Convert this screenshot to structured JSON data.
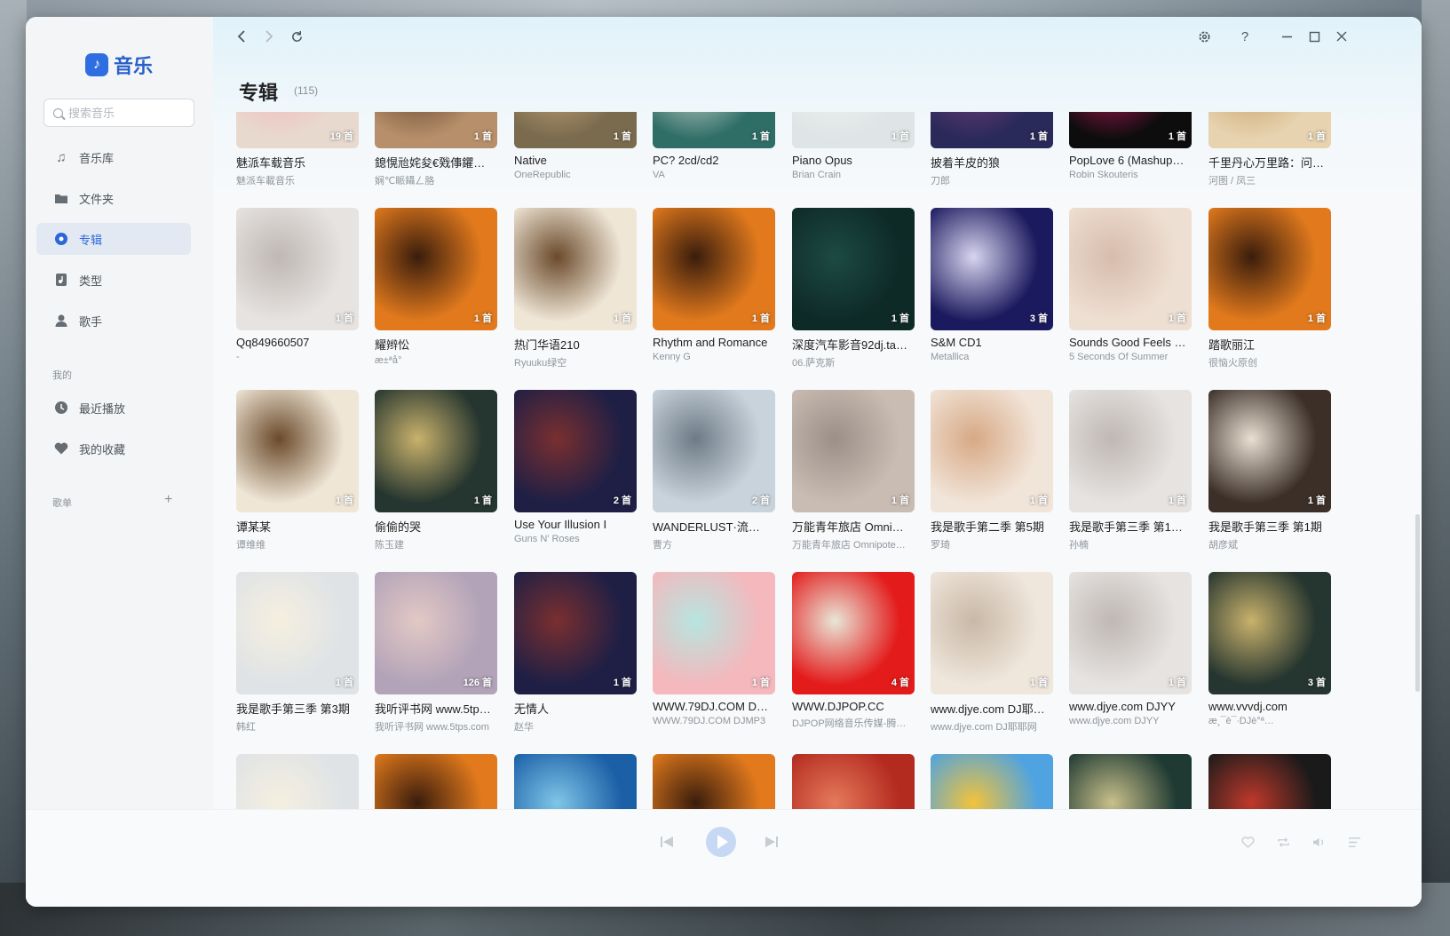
{
  "app": {
    "name": "音乐"
  },
  "search": {
    "placeholder": "搜索音乐"
  },
  "sidebar": {
    "items": [
      {
        "label": "音乐库",
        "icon": "music-note-icon"
      },
      {
        "label": "文件夹",
        "icon": "folder-icon"
      },
      {
        "label": "专辑",
        "icon": "album-disc-icon",
        "active": true
      },
      {
        "label": "类型",
        "icon": "genre-icon"
      },
      {
        "label": "歌手",
        "icon": "singer-icon"
      }
    ],
    "my_section": "我的",
    "my_items": [
      {
        "label": "最近播放",
        "icon": "clock-icon"
      },
      {
        "label": "我的收藏",
        "icon": "heart-icon"
      }
    ],
    "playlist_section": "歌单",
    "add_playlist": "+"
  },
  "page": {
    "title": "专辑",
    "count": "(115)"
  },
  "albums": [
    {
      "title": "魅派车载音乐",
      "artist": "魅派车載音乐",
      "count": "19 首",
      "colors": [
        "#e8d9cf",
        "#f2b6b6"
      ]
    },
    {
      "title": "鎴愰兘姹夋€戣倳鑺…",
      "artist": "娴℃眽鑷ㄥ胳",
      "count": "1 首",
      "colors": [
        "#b78f6a",
        "#5b3f2a"
      ]
    },
    {
      "title": "Native",
      "artist": "OneRepublic",
      "count": "1 首",
      "colors": [
        "#7a6b4e",
        "#c9a77c"
      ]
    },
    {
      "title": "PC? 2cd/cd2",
      "artist": "VA",
      "count": "1 首",
      "colors": [
        "#2f6e67",
        "#d9ddd6"
      ]
    },
    {
      "title": "Piano Opus",
      "artist": "Brian Crain",
      "count": "1 首",
      "colors": [
        "#dfe5e6",
        "#eef1f1"
      ]
    },
    {
      "title": "披着羊皮的狼",
      "artist": "刀郎",
      "count": "1 首",
      "colors": [
        "#2a2a5a",
        "#7b3f7a"
      ]
    },
    {
      "title": "PopLove 6 (Mashup…",
      "artist": "Robin Skouteris",
      "count": "1 首",
      "colors": [
        "#0d0d0d",
        "#c2185b"
      ]
    },
    {
      "title": "千里丹心万里路：问…",
      "artist": "河图 / 凤三",
      "count": "1 首",
      "colors": [
        "#e7d3b0",
        "#c59c61"
      ]
    },
    {
      "title": "Qq849660507",
      "artist": "-",
      "count": "1 首",
      "colors": [
        "#e6e3e1",
        "#bfb8b3"
      ]
    },
    {
      "title": "耀辫忪",
      "artist": "æ±ªå°",
      "count": "1 首",
      "colors": [
        "#e27a1d",
        "#3a1d0c"
      ]
    },
    {
      "title": "热门华语210",
      "artist": "Ryuuku绿空",
      "count": "1 首",
      "colors": [
        "#efe6d6",
        "#6b4a2b"
      ]
    },
    {
      "title": "Rhythm and Romance",
      "artist": "Kenny G",
      "count": "1 首",
      "colors": [
        "#e27a1d",
        "#3a1d0c"
      ]
    },
    {
      "title": "深度汽车影音92dj.ta…",
      "artist": "06.萨克斯",
      "count": "1 首",
      "colors": [
        "#0e2a27",
        "#1d4a44"
      ]
    },
    {
      "title": "S&M CD1",
      "artist": "Metallica",
      "count": "3 首",
      "colors": [
        "#1b1a5e",
        "#d8d4ef"
      ]
    },
    {
      "title": "Sounds Good Feels …",
      "artist": "5 Seconds Of Summer",
      "count": "1 首",
      "colors": [
        "#eedfd3",
        "#d7bcab"
      ]
    },
    {
      "title": "踏歌丽江",
      "artist": "很恼火原创",
      "count": "1 首",
      "colors": [
        "#e27a1d",
        "#3a1d0c"
      ]
    },
    {
      "title": "谭某某",
      "artist": "谭维维",
      "count": "1 首",
      "colors": [
        "#efe6d6",
        "#6b4a2b"
      ]
    },
    {
      "title": "偷偷的哭",
      "artist": "陈玉建",
      "count": "1 首",
      "colors": [
        "#25352f",
        "#c9b26c"
      ]
    },
    {
      "title": "Use Your Illusion I",
      "artist": "Guns N' Roses",
      "count": "2 首",
      "colors": [
        "#1f1f45",
        "#7a2f2f"
      ]
    },
    {
      "title": "WANDERLUST·流…",
      "artist": "曹方",
      "count": "2 首",
      "colors": [
        "#c9d3dc",
        "#6e7b86"
      ]
    },
    {
      "title": "万能青年旅店 Omni…",
      "artist": "万能青年旅店 Omnipote…",
      "count": "1 首",
      "colors": [
        "#c9bcb3",
        "#9b8f87"
      ]
    },
    {
      "title": "我是歌手第二季 第5期",
      "artist": "罗琦",
      "count": "1 首",
      "colors": [
        "#f1e4d8",
        "#d7a985"
      ]
    },
    {
      "title": "我是歌手第三季 第1…",
      "artist": "孙楠",
      "count": "1 首",
      "colors": [
        "#e6e3e1",
        "#bfb8b3"
      ]
    },
    {
      "title": "我是歌手第三季 第1期",
      "artist": "胡彦斌",
      "count": "1 首",
      "colors": [
        "#3b2f28",
        "#e9dfd2"
      ]
    },
    {
      "title": "我是歌手第三季 第3期",
      "artist": "韩红",
      "count": "1 首",
      "colors": [
        "#dfe3e6",
        "#f5efe0"
      ]
    },
    {
      "title": "我听评书网 www.5tp…",
      "artist": "我听评书网 www.5tps.com",
      "count": "126 首",
      "colors": [
        "#b2a3b8",
        "#e3c9c5"
      ]
    },
    {
      "title": "无情人",
      "artist": "赵华",
      "count": "1 首",
      "colors": [
        "#1f1f45",
        "#7a2f2f"
      ]
    },
    {
      "title": "WWW.79DJ.COM D…",
      "artist": "WWW.79DJ.COM DJMP3",
      "count": "1 首",
      "colors": [
        "#f4b8bd",
        "#b7e5df"
      ]
    },
    {
      "title": "WWW.DJPOP.CC",
      "artist": "DJPOP网络音乐传媒-腾…",
      "count": "4 首",
      "colors": [
        "#e31b1b",
        "#e9e6d8"
      ]
    },
    {
      "title": "www.djye.com DJ耶…",
      "artist": "www.djye.com DJ耶耶网",
      "count": "1 首",
      "colors": [
        "#efe6dc",
        "#c9b8a6"
      ]
    },
    {
      "title": "www.djye.com DJYY",
      "artist": "www.djye.com DJYY",
      "count": "1 首",
      "colors": [
        "#e6e3e1",
        "#bfb8b3"
      ]
    },
    {
      "title": "www.vvvdj.com",
      "artist": "æ¸¯è¯∙DJè°ª…",
      "count": "3 首",
      "colors": [
        "#25352f",
        "#c9b26c"
      ]
    },
    {
      "title": "",
      "artist": "",
      "count": "",
      "colors": [
        "#dfe3e6",
        "#f5efe0"
      ]
    },
    {
      "title": "",
      "artist": "",
      "count": "",
      "colors": [
        "#e27a1d",
        "#3a1d0c"
      ]
    },
    {
      "title": "",
      "artist": "",
      "count": "",
      "colors": [
        "#1b5fa6",
        "#7fc6e8"
      ]
    },
    {
      "title": "",
      "artist": "",
      "count": "",
      "colors": [
        "#e27a1d",
        "#3a1d0c"
      ]
    },
    {
      "title": "",
      "artist": "",
      "count": "",
      "colors": [
        "#b32a1f",
        "#e57a5a"
      ]
    },
    {
      "title": "",
      "artist": "",
      "count": "",
      "colors": [
        "#4fa3e0",
        "#f2c33b"
      ]
    },
    {
      "title": "",
      "artist": "",
      "count": "",
      "colors": [
        "#1e3a33",
        "#c9c08a"
      ]
    },
    {
      "title": "",
      "artist": "",
      "count": "",
      "colors": [
        "#1a1a1a",
        "#c0392b"
      ]
    }
  ],
  "colors": {
    "accent": "#2b67d8",
    "active_bg": "#e3e9f2",
    "play_button": "#c7d8f5"
  }
}
